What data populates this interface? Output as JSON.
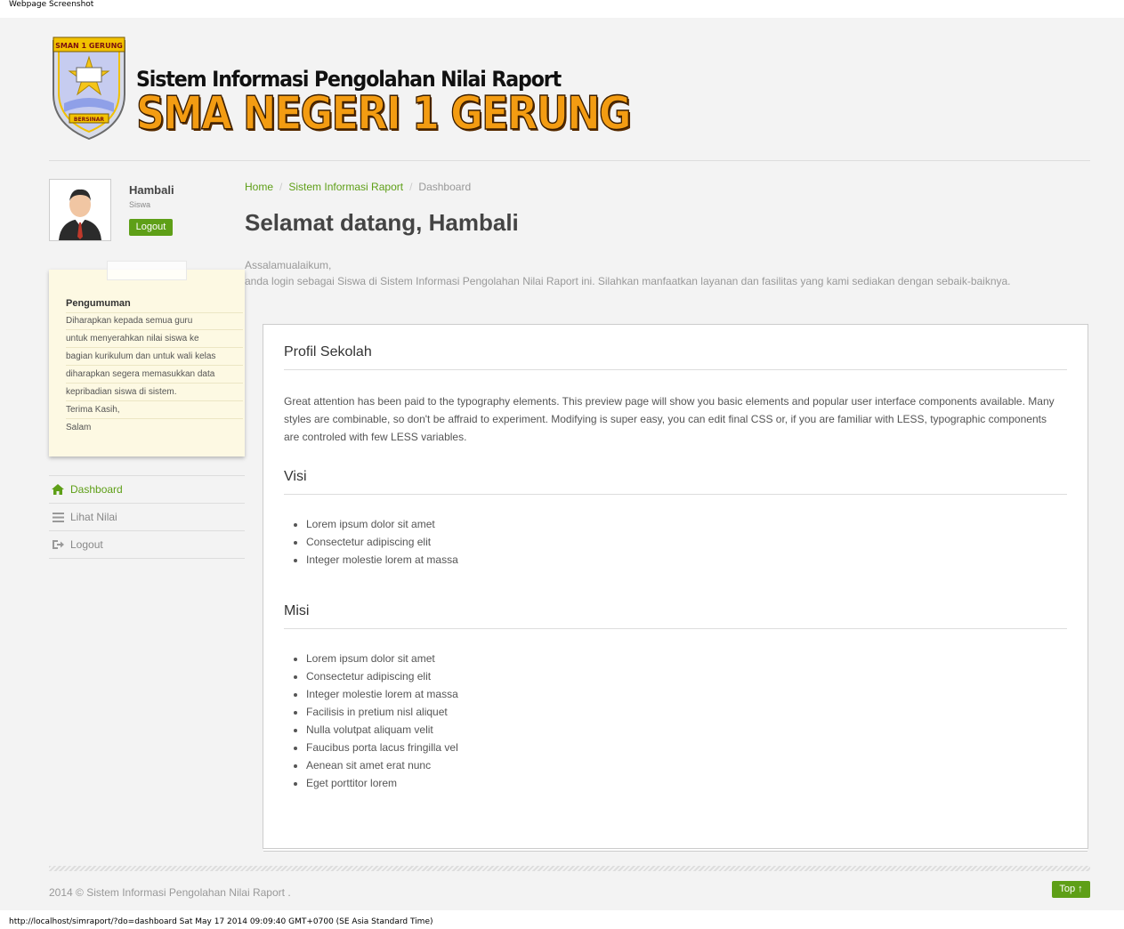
{
  "captions": {
    "top": "Webpage Screenshot",
    "bottom": "http://localhost/simraport/?do=dashboard Sat May 17 2014 09:09:40 GMT+0700 (SE Asia Standard Time)"
  },
  "header": {
    "crest_top": "SMAN 1 GERUNG",
    "crest_ribbon": "BERSINAR",
    "subtitle": "Sistem Informasi Pengolahan Nilai Raport",
    "school_name": "SMA NEGERI 1 GERUNG"
  },
  "user": {
    "name": "Hambali",
    "role": "Siswa",
    "logout_label": "Logout"
  },
  "announcement": {
    "title": "Pengumuman",
    "lines": [
      "Diharapkan kepada semua guru",
      "untuk menyerahkan nilai siswa ke",
      "bagian kurikulum dan untuk wali kelas",
      "diharapkan segera memasukkan data",
      "kepribadian siswa di sistem.",
      "Terima Kasih,",
      "Salam"
    ]
  },
  "side_nav": [
    {
      "label": "Dashboard",
      "icon": "home-icon"
    },
    {
      "label": "Lihat Nilai",
      "icon": "list-icon"
    },
    {
      "label": "Logout",
      "icon": "sign-out-icon"
    }
  ],
  "breadcrumb": [
    "Home",
    "Sistem Informasi Raport",
    "Dashboard"
  ],
  "page_title": "Selamat datang, Hambali",
  "intro": {
    "greeting": "Assalamualaikum,",
    "text": "anda login sebagai Siswa di Sistem Informasi Pengolahan Nilai Raport ini. Silahkan manfaatkan layanan dan fasilitas yang kami sediakan dengan sebaik-baiknya."
  },
  "profile": {
    "title": "Profil Sekolah",
    "text": "Great attention has been paid to the typography elements. This preview page will show you basic elements and popular user interface components available. Many styles are combinable, so don't be affraid to experiment. Modifying is super easy, you can edit final CSS or, if you are familiar with LESS, typographic components are controled with few LESS variables.",
    "visi_title": "Visi",
    "visi_items": [
      "Lorem ipsum dolor sit amet",
      "Consectetur adipiscing elit",
      "Integer molestie lorem at massa"
    ],
    "misi_title": "Misi",
    "misi_items": [
      "Lorem ipsum dolor sit amet",
      "Consectetur adipiscing elit",
      "Integer molestie lorem at massa",
      "Facilisis in pretium nisl aliquet",
      "Nulla volutpat aliquam velit",
      "Faucibus porta lacus fringilla vel",
      "Aenean sit amet erat nunc",
      "Eget porttitor lorem"
    ]
  },
  "footer": {
    "text": "2014 © Sistem Informasi Pengolahan Nilai Raport .",
    "top_label": "Top ↑"
  },
  "colors": {
    "accent": "#5e9f17",
    "background": "#f3f3f3",
    "school_name": "#f39c12"
  }
}
